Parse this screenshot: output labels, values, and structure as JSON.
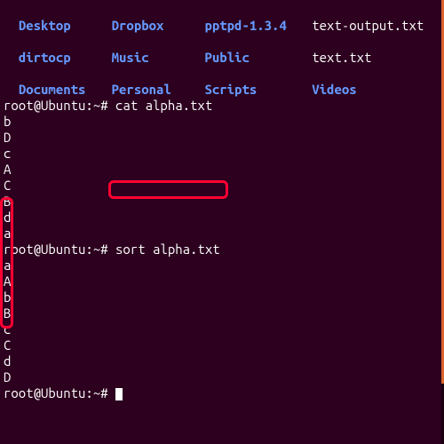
{
  "ls": {
    "row0": {
      "c0": "Desktop",
      "c1": "Dropbox",
      "c2": "pptpd-1.3.4",
      "c3": "text-output.txt"
    },
    "row1": {
      "c0": "dirtocp",
      "c1": "Music",
      "c2": "Public",
      "c3": "text.txt"
    },
    "row2": {
      "c0": "Documents",
      "c1": "Personal",
      "c2": "Scripts",
      "c3": "Videos"
    }
  },
  "prompt": {
    "user": "root@Ubuntu",
    "sep": ":",
    "path": "~",
    "symbol": "#"
  },
  "commands": {
    "cat": "cat alpha.txt",
    "sort": "sort alpha.txt"
  },
  "cat_output": [
    "b",
    "D",
    "c",
    "A",
    "C",
    "B",
    "d",
    "a"
  ],
  "sort_output": [
    "a",
    "A",
    "b",
    "B",
    "c",
    "C",
    "d",
    "D"
  ]
}
